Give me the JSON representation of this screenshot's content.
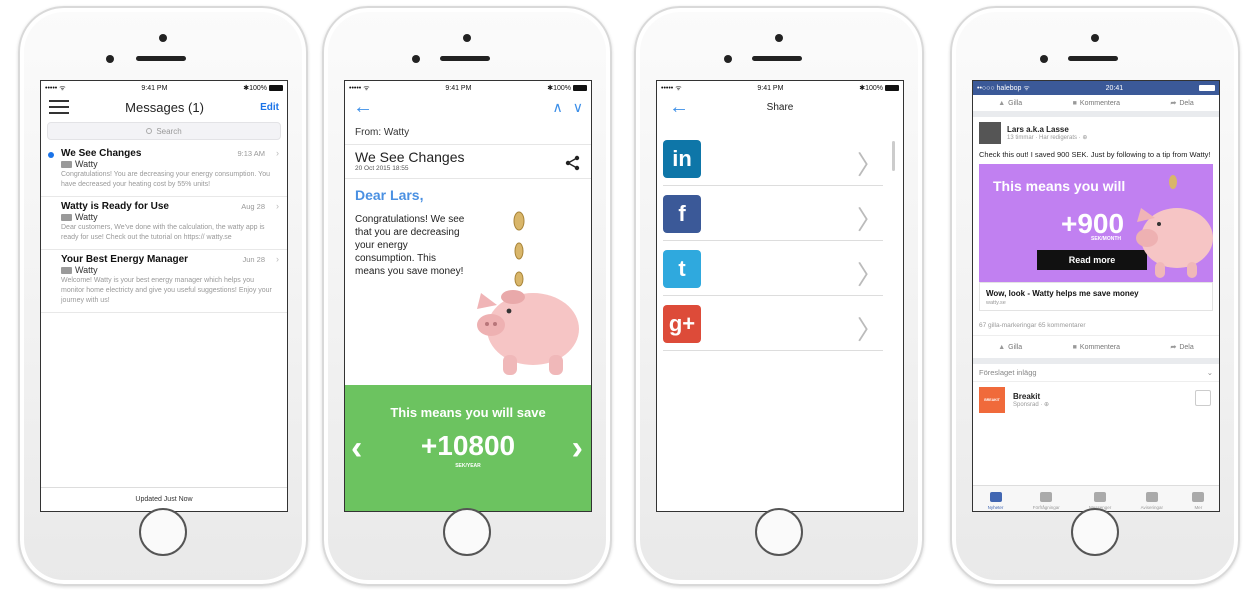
{
  "status_bar": {
    "carrier": "••••• ᯤ",
    "time": "9:41 PM",
    "battery": "✱100%"
  },
  "messages_screen": {
    "title": "Messages (1)",
    "edit_label": "Edit",
    "search_placeholder": "Search",
    "items": [
      {
        "subject": "We See Changes",
        "date": "9:13 AM",
        "sender": "Watty",
        "unread": true,
        "body": "Congratulations! You are decreasing your energy consumption. You have decreased your heating cost by 55% units!"
      },
      {
        "subject": "Watty is Ready for Use",
        "date": "Aug 28",
        "sender": "Watty",
        "unread": false,
        "body": "Dear customers, We've done with the calculation, the watty app is ready for use! Check out the tutorial on https:// watty.se"
      },
      {
        "subject": "Your Best Energy Manager",
        "date": "Jun 28",
        "sender": "Watty",
        "unread": false,
        "body": "Welcome! Watty is your best energy manager which helps you monitor home electricty and give you useful suggestions! Enjoy your journey with us!"
      }
    ],
    "footer": "Updated Just Now"
  },
  "detail_screen": {
    "from": "From: Watty",
    "subject": "We See Changes",
    "date": "20 Oct 2015 18:55",
    "greeting": "Dear Lars,",
    "body": "Congratulations! We see that you are decreasing your energy consumption. This means you save money!",
    "banner_text": "This means you will save",
    "amount": "+10800",
    "unit": "SEK/YEAR"
  },
  "share_screen": {
    "title": "Share",
    "options": [
      {
        "name": "linkedin-icon",
        "glyph": "in",
        "color": "#0e76a8"
      },
      {
        "name": "facebook-icon",
        "glyph": "f",
        "color": "#3b5998"
      },
      {
        "name": "twitter-icon",
        "glyph": "t",
        "color": "#2fa9de"
      },
      {
        "name": "google-plus-icon",
        "glyph": "g+",
        "color": "#dd4b39"
      }
    ]
  },
  "facebook_screen": {
    "carrier": "••○○○ halebop ᯤ",
    "time": "20:41",
    "actions": {
      "like": "Gilla",
      "comment": "Kommentera",
      "share": "Dela"
    },
    "post": {
      "author": "Lars a.k.a Lasse",
      "meta": "13 timmar · Har redigerats · ⊕",
      "text": "Check this out! I saved 900 SEK. Just by following to a tip from Watty!",
      "ad_line": "This means you will",
      "ad_amount": "+900",
      "ad_unit": "SEK/MONTH",
      "ad_button": "Read more",
      "link_title": "Wow, look - Watty helps me save money",
      "link_url": "watty.se",
      "counts": "67 gilla-markeringar  65 kommentarer"
    },
    "suggested_label": "Föreslaget inlägg",
    "sponsor": {
      "logo_text": "BREAKIT",
      "name": "Breakit",
      "meta": "Sponsrad · ⊕"
    },
    "tabs": [
      "Nyheter",
      "Förfrågningar",
      "Messenger",
      "Aviseringar",
      "Mer"
    ]
  }
}
